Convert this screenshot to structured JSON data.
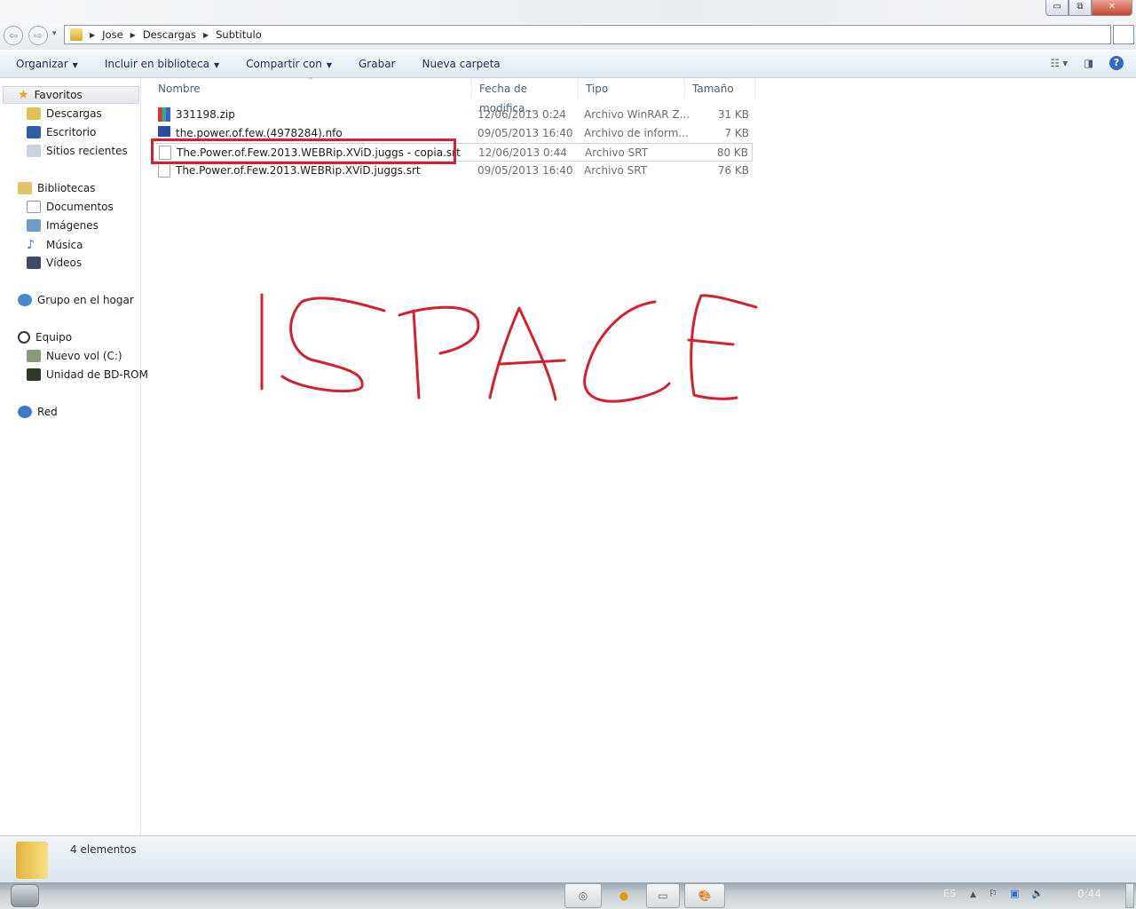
{
  "window": {
    "minimize": "▭",
    "maximize": "⧉",
    "close": "✕"
  },
  "nav": {
    "back": "⇦",
    "forward": "⇨",
    "history": "▾",
    "breadcrumb": [
      "Jose",
      "Descargas",
      "Subtitulo"
    ]
  },
  "toolbar": {
    "organize": "Organizar",
    "include_library": "Incluir en biblioteca",
    "share": "Compartir con",
    "burn": "Grabar",
    "new_folder": "Nueva carpeta",
    "help": "?"
  },
  "sidebar": {
    "favorites": {
      "label": "Favoritos",
      "items": [
        "Descargas",
        "Escritorio",
        "Sitios recientes"
      ]
    },
    "libraries": {
      "label": "Bibliotecas",
      "items": [
        "Documentos",
        "Imágenes",
        "Música",
        "Vídeos"
      ]
    },
    "homegroup": "Grupo en el hogar",
    "computer": {
      "label": "Equipo",
      "items": [
        "Nuevo vol (C:)",
        "Unidad de BD-ROM"
      ]
    },
    "network": "Red"
  },
  "columns": {
    "name": "Nombre",
    "date": "Fecha de modifica...",
    "type": "Tipo",
    "size": "Tamaño"
  },
  "files": [
    {
      "name": "331198.zip",
      "date": "12/06/2013 0:24",
      "type": "Archivo WinRAR Z...",
      "size": "31 KB",
      "icon": "winrar-icon"
    },
    {
      "name": "the.power.of.few.(4978284).nfo",
      "date": "09/05/2013 16:40",
      "type": "Archivo de inform...",
      "size": "7 KB",
      "icon": "info-file-icon"
    },
    {
      "name": "The.Power.of.Few.2013.WEBRip.XViD.juggs - copia.srt",
      "date": "12/06/2013 0:44",
      "type": "Archivo SRT",
      "size": "80 KB",
      "icon": "file-icon"
    },
    {
      "name": "The.Power.of.Few.2013.WEBRip.XViD.juggs.srt",
      "date": "09/05/2013 16:40",
      "type": "Archivo SRT",
      "size": "76 KB",
      "icon": "file-icon"
    }
  ],
  "annotation": {
    "handwritten_text": "ISPACE",
    "color": "#d1222e"
  },
  "status": {
    "count": "4 elementos"
  },
  "taskbar": {
    "language": "ES",
    "tray_arrow": "▲",
    "clock": "0:44"
  }
}
